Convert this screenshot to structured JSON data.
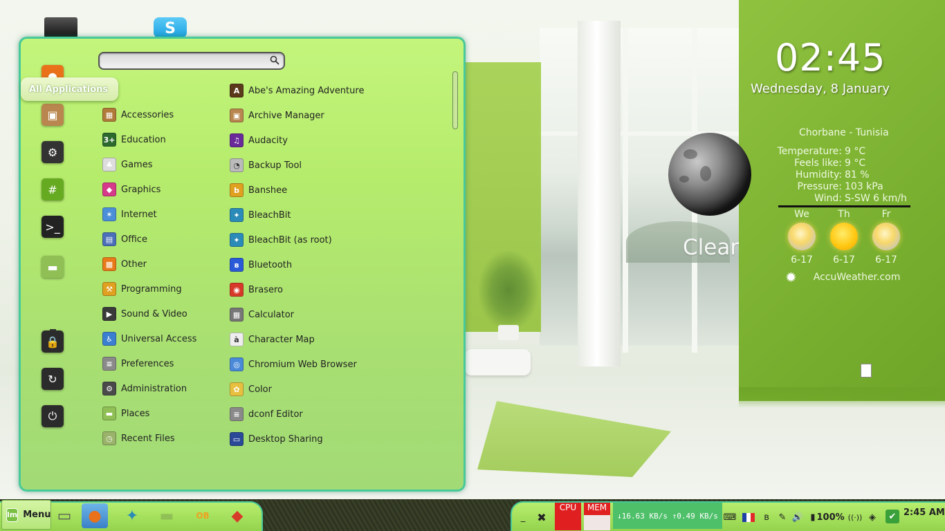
{
  "desktop": {
    "skype_glyph": "S"
  },
  "clock": {
    "time": "02:45",
    "date": "Wednesday, 8 January"
  },
  "weather": {
    "condition": "Clear",
    "location": "Chorbane - Tunisia",
    "rows": [
      {
        "label": "Temperature:",
        "value": "9 °C"
      },
      {
        "label": "Feels like:",
        "value": "9 °C"
      },
      {
        "label": "Humidity:",
        "value": "81 %"
      },
      {
        "label": "Pressure:",
        "value": "103 kPa"
      },
      {
        "label": "Wind:",
        "value": "S-SW 6 km/h"
      }
    ],
    "forecast": [
      {
        "day": "We",
        "range": "6-17",
        "icon": "partly-sunny-icon"
      },
      {
        "day": "Th",
        "range": "6-17",
        "icon": "sunny-icon"
      },
      {
        "day": "Fr",
        "range": "6-17",
        "icon": "cloudy-sun-icon"
      }
    ],
    "provider": "AccuWeather.com"
  },
  "menu": {
    "search": {
      "placeholder": "",
      "value": ""
    },
    "favorites": [
      {
        "name": "firefox-icon",
        "glyph": "●",
        "color": "#e8711a"
      },
      {
        "name": "package-manager-icon",
        "glyph": "▣",
        "color": "#b8864e"
      },
      {
        "name": "system-settings-icon",
        "glyph": "⚙",
        "color": "#333333"
      },
      {
        "name": "hexchat-icon",
        "glyph": "#",
        "color": "#66aa22"
      },
      {
        "name": "terminal-icon",
        "glyph": ">_",
        "color": "#222222"
      },
      {
        "name": "files-folder-icon",
        "glyph": "▬",
        "color": "#8fbf55"
      },
      {
        "name": "lock-screen-icon",
        "glyph": "🔒",
        "color": "#2b2b2b"
      },
      {
        "name": "logout-icon",
        "glyph": "↻",
        "color": "#2b2b2b"
      },
      {
        "name": "shutdown-icon",
        "glyph": "⏻",
        "color": "#2b2b2b"
      }
    ],
    "active_category": "All Applications",
    "categories": [
      {
        "label": "Accessories",
        "icon": "accessories-icon",
        "color": "#b07a3a",
        "glyph": "▦"
      },
      {
        "label": "Education",
        "icon": "education-icon",
        "color": "#2d6a2d",
        "glyph": "3+"
      },
      {
        "label": "Games",
        "icon": "games-icon",
        "color": "#dddddd",
        "glyph": "♣"
      },
      {
        "label": "Graphics",
        "icon": "graphics-icon",
        "color": "#d63a8a",
        "glyph": "◆"
      },
      {
        "label": "Internet",
        "icon": "internet-icon",
        "color": "#4b8fd8",
        "glyph": "✶"
      },
      {
        "label": "Office",
        "icon": "office-icon",
        "color": "#4b6fb8",
        "glyph": "▤"
      },
      {
        "label": "Other",
        "icon": "other-icon",
        "color": "#e87a1a",
        "glyph": "▩"
      },
      {
        "label": "Programming",
        "icon": "programming-icon",
        "color": "#e0a020",
        "glyph": "⚒"
      },
      {
        "label": "Sound & Video",
        "icon": "sound-video-icon",
        "color": "#3a3a3a",
        "glyph": "▶"
      },
      {
        "label": "Universal Access",
        "icon": "universal-access-icon",
        "color": "#3a7fd0",
        "glyph": "♿"
      },
      {
        "label": "Preferences",
        "icon": "preferences-icon",
        "color": "#8a8a8a",
        "glyph": "≡"
      },
      {
        "label": "Administration",
        "icon": "administration-icon",
        "color": "#4a4a4a",
        "glyph": "⚙"
      },
      {
        "label": "Places",
        "icon": "places-icon",
        "color": "#8fbf55",
        "glyph": "▬"
      },
      {
        "label": "Recent Files",
        "icon": "recent-files-icon",
        "color": "#9ab36a",
        "glyph": "◷"
      }
    ],
    "apps": [
      {
        "label": "Abe's Amazing Adventure",
        "icon": "abe-icon",
        "color": "#5a3a1a",
        "glyph": "A"
      },
      {
        "label": "Archive Manager",
        "icon": "archive-icon",
        "color": "#b8864e",
        "glyph": "▣"
      },
      {
        "label": "Audacity",
        "icon": "audacity-icon",
        "color": "#6a2a9a",
        "glyph": "♫"
      },
      {
        "label": "Backup Tool",
        "icon": "backup-icon",
        "color": "#bbbbbb",
        "glyph": "◔"
      },
      {
        "label": "Banshee",
        "icon": "banshee-icon",
        "color": "#e0a020",
        "glyph": "b"
      },
      {
        "label": "BleachBit",
        "icon": "bleachbit-icon",
        "color": "#2a8ab8",
        "glyph": "✦"
      },
      {
        "label": "BleachBit (as root)",
        "icon": "bleachbit-root-icon",
        "color": "#2a8ab8",
        "glyph": "✦"
      },
      {
        "label": "Bluetooth",
        "icon": "bluetooth-icon",
        "color": "#2a5ad8",
        "glyph": "ʙ"
      },
      {
        "label": "Brasero",
        "icon": "brasero-icon",
        "color": "#d83a2a",
        "glyph": "◉"
      },
      {
        "label": "Calculator",
        "icon": "calculator-icon",
        "color": "#777777",
        "glyph": "▦"
      },
      {
        "label": "Character Map",
        "icon": "character-map-icon",
        "color": "#eeeeee",
        "glyph": "à"
      },
      {
        "label": "Chromium Web Browser",
        "icon": "chromium-icon",
        "color": "#4a8ad8",
        "glyph": "◎"
      },
      {
        "label": "Color",
        "icon": "color-icon",
        "color": "#e8c040",
        "glyph": "✿"
      },
      {
        "label": "dconf Editor",
        "icon": "dconf-icon",
        "color": "#8a8a8a",
        "glyph": "≡"
      },
      {
        "label": "Desktop Sharing",
        "icon": "desktop-sharing-icon",
        "color": "#2a4a98",
        "glyph": "▭"
      }
    ]
  },
  "taskbar": {
    "menu_label": "Menu",
    "mint_glyph": "lm",
    "launchers": [
      {
        "name": "show-desktop-icon",
        "glyph": "▭",
        "color": "#555555"
      },
      {
        "name": "firefox-taskbar-icon",
        "glyph": "●",
        "color": "#e8711a"
      },
      {
        "name": "bleachbit-taskbar-icon",
        "glyph": "✦",
        "color": "#2a8ab8"
      },
      {
        "name": "files-taskbar-icon",
        "glyph": "▬",
        "color": "#8fbf55"
      },
      {
        "name": "openbox-config-icon",
        "glyph": "OB",
        "color": "#f0a020"
      },
      {
        "name": "cube-app-icon",
        "glyph": "◆",
        "color": "#d83a2a"
      }
    ],
    "cpu_label": "CPU",
    "mem_label": "MEM",
    "netspeed": "↓16.63 KB/s ↑0.49 KB/s",
    "tray": [
      {
        "name": "minimize-icon",
        "glyph": "_"
      },
      {
        "name": "close-icon",
        "glyph": "✖"
      },
      {
        "name": "keyboard-icon",
        "glyph": "⌨"
      },
      {
        "name": "french-flag-icon",
        "glyph": "FR"
      },
      {
        "name": "bluetooth-tray-icon",
        "glyph": "ʙ"
      },
      {
        "name": "pen-icon",
        "glyph": "✎"
      },
      {
        "name": "volume-icon",
        "glyph": "🔊"
      },
      {
        "name": "battery-icon",
        "glyph": "▮"
      },
      {
        "name": "wifi-icon",
        "glyph": "((·))"
      },
      {
        "name": "shield-icon",
        "glyph": "◈"
      },
      {
        "name": "update-icon",
        "glyph": "✔"
      }
    ],
    "battery_text": "100%",
    "clock": "2:45 AM"
  }
}
